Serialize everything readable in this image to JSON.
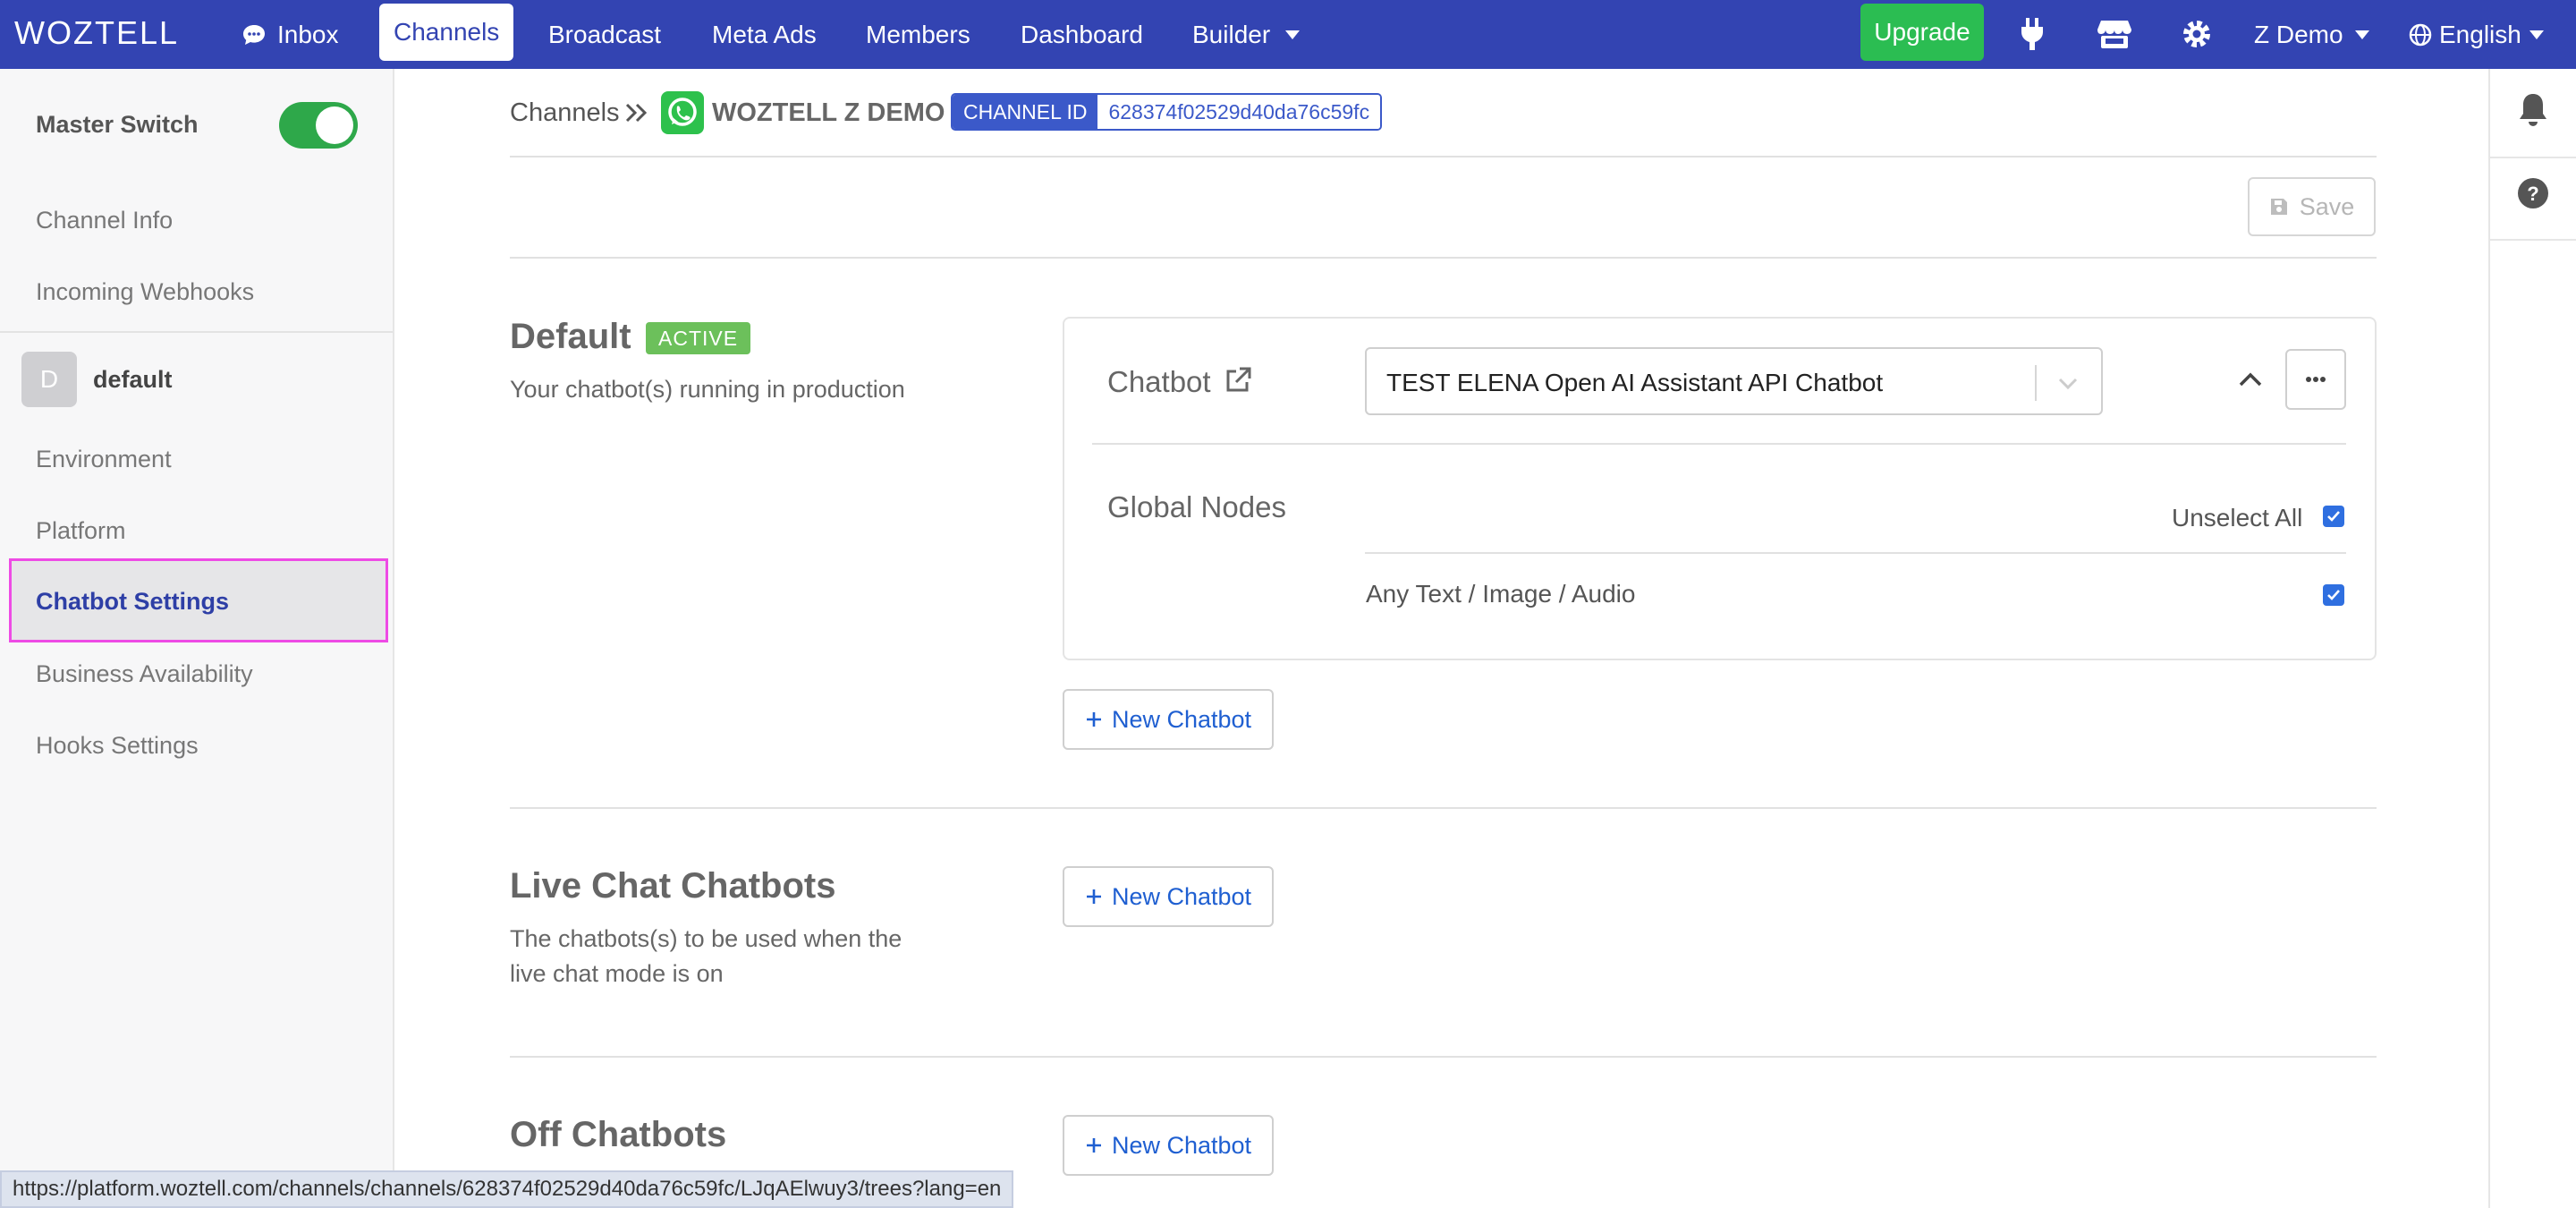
{
  "topnav": {
    "logo": "WOZTELL",
    "items": [
      {
        "label": "Inbox"
      },
      {
        "label": "Channels"
      },
      {
        "label": "Broadcast"
      },
      {
        "label": "Meta Ads"
      },
      {
        "label": "Members"
      },
      {
        "label": "Dashboard"
      },
      {
        "label": "Builder"
      }
    ],
    "upgrade_label": "Upgrade",
    "account_label": "Z Demo",
    "language_label": "English",
    "colors": {
      "bar": "#3344b2",
      "upgrade": "#2bbd52"
    }
  },
  "sidebar": {
    "master_switch_label": "Master Switch",
    "master_switch_on": true,
    "items": [
      {
        "label": "Channel Info"
      },
      {
        "label": "Incoming Webhooks"
      }
    ],
    "env_avatar": "D",
    "env_name": "default",
    "env_items": [
      {
        "label": "Environment"
      },
      {
        "label": "Platform"
      },
      {
        "label": "Chatbot Settings",
        "active": true
      },
      {
        "label": "Business Availability"
      },
      {
        "label": "Hooks Settings"
      }
    ]
  },
  "breadcrumb": {
    "root": "Channels",
    "channel_name": "WOZTELL Z DEMO",
    "channel_id_label": "CHANNEL ID",
    "channel_id_value": "628374f02529d40da76c59fc"
  },
  "toolbar": {
    "save_label": "Save"
  },
  "default_section": {
    "title": "Default",
    "badge": "ACTIVE",
    "description": "Your chatbot(s) running in production",
    "chatbot_label": "Chatbot",
    "chatbot_selected": "TEST ELENA Open AI Assistant API Chatbot",
    "global_nodes_label": "Global Nodes",
    "unselect_all_label": "Unselect All",
    "nodes": [
      {
        "label": "Any Text / Image / Audio",
        "checked": true
      }
    ],
    "new_chatbot_label": "New Chatbot"
  },
  "live_chat_section": {
    "title": "Live Chat Chatbots",
    "description": "The chatbots(s) to be used when the live chat mode is on",
    "new_chatbot_label": "New Chatbot"
  },
  "off_section": {
    "title": "Off Chatbots",
    "new_chatbot_label": "New Chatbot"
  },
  "status_bar": {
    "url": "https://platform.woztell.com/channels/channels/628374f02529d40da76c59fc/LJqAElwuy3/trees?lang=en"
  }
}
